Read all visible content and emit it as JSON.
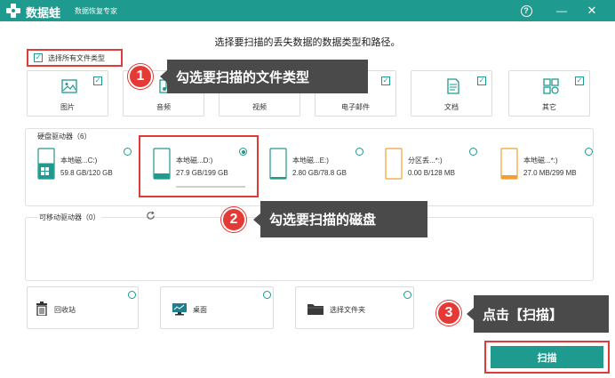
{
  "app": {
    "name": "数据蛙",
    "subtitle": "数据恢复专家"
  },
  "window_buttons": {
    "help": "?",
    "minimize": "—",
    "close": "✕"
  },
  "main_title": "选择要扫描的丢失数据的数据类型和路径。",
  "select_all": {
    "label": "选择所有文件类型",
    "checked": true
  },
  "file_types": [
    {
      "label": "图片",
      "icon": "image-icon",
      "checked": true
    },
    {
      "label": "音频",
      "icon": "audio-icon",
      "checked": true
    },
    {
      "label": "视频",
      "icon": "video-icon",
      "checked": true
    },
    {
      "label": "电子邮件",
      "icon": "email-icon",
      "checked": true
    },
    {
      "label": "文档",
      "icon": "document-icon",
      "checked": true
    },
    {
      "label": "其它",
      "icon": "other-icon",
      "checked": true
    }
  ],
  "hard_drives": {
    "title": "硬盘驱动器（6）",
    "disks": [
      {
        "name": "本地磁...C:)",
        "size": "59.8 GB/120 GB",
        "selected": false,
        "fill": 0.5,
        "color": "#1e9a8e"
      },
      {
        "name": "本地磁...D:)",
        "size": "27.9 GB/199 GB",
        "selected": true,
        "fill": 0.14,
        "color": "#1e9a8e"
      },
      {
        "name": "本地磁...E:)",
        "size": "2.80 GB/78.8 GB",
        "selected": false,
        "fill": 0.04,
        "color": "#1e9a8e"
      },
      {
        "name": "分区丢...*:)",
        "size": "0.00  B/128 MB",
        "selected": false,
        "fill": 0,
        "color": "#f0a030"
      },
      {
        "name": "本地磁...*:)",
        "size": "27.0 MB/299 MB",
        "selected": false,
        "fill": 0.09,
        "color": "#f0a030"
      }
    ]
  },
  "removable": {
    "title": "可移动驱动器（0）"
  },
  "locations": [
    {
      "label": "回收站",
      "icon": "recycle-bin-icon"
    },
    {
      "label": "桌面",
      "icon": "desktop-icon"
    },
    {
      "label": "选择文件夹",
      "icon": "folder-icon"
    }
  ],
  "tips": [
    {
      "num": "1",
      "text": "勾选要扫描的文件类型"
    },
    {
      "num": "2",
      "text": "勾选要扫描的磁盘"
    },
    {
      "num": "3",
      "text": "点击【扫描】"
    }
  ],
  "scan_button": "扫描",
  "colors": {
    "accent": "#1e9a8e",
    "highlight": "#e03a3a",
    "badge": "#e53935"
  }
}
